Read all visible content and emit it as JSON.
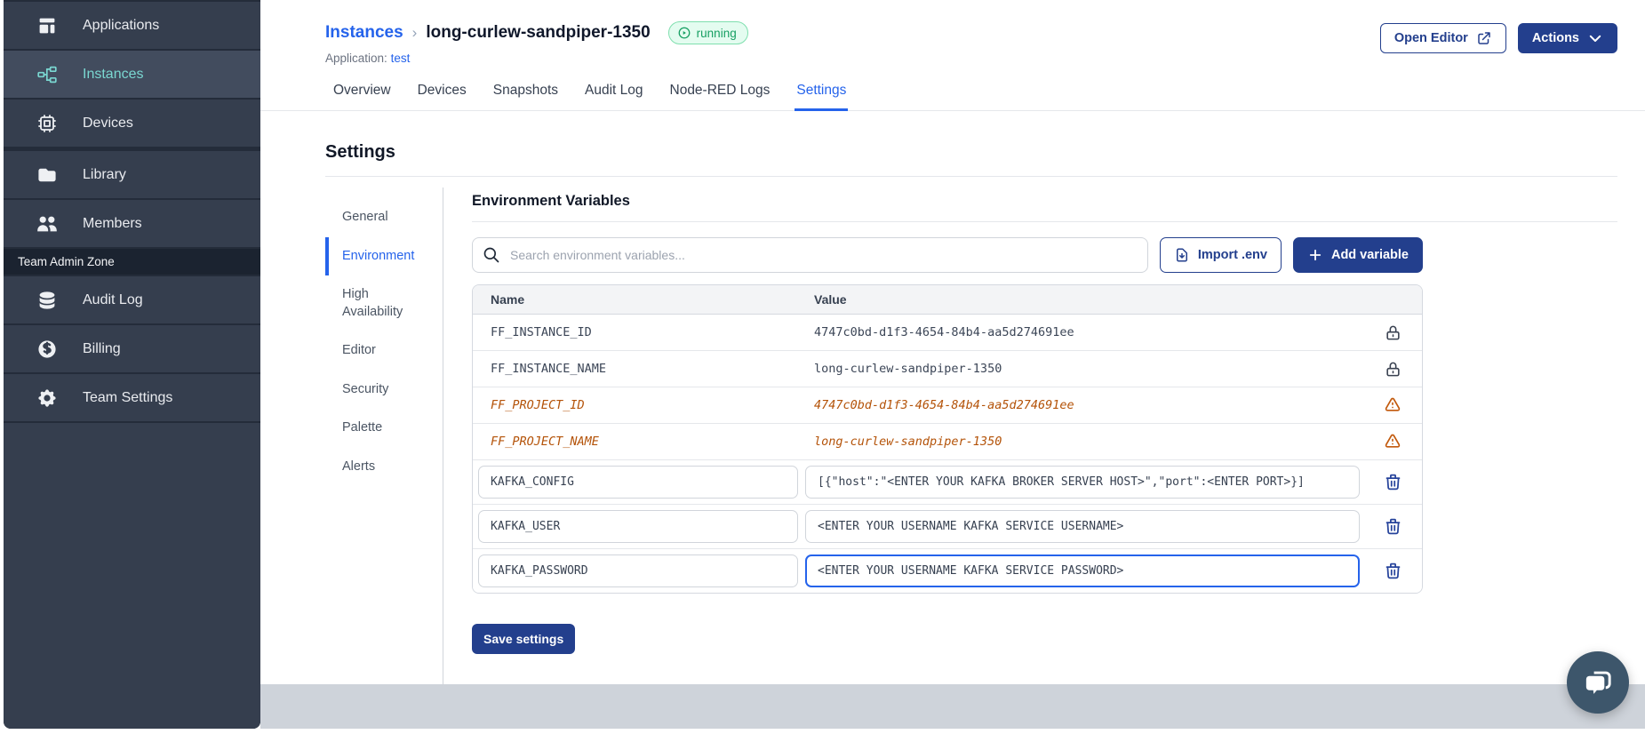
{
  "colors": {
    "primary_blue": "#233f8d",
    "link_blue": "#2563eb",
    "sidebar_active_teal": "#7ad7d1",
    "success_green": "#169f62",
    "warning_orange": "#b45309"
  },
  "sidebar": {
    "groups": [
      {
        "items": [
          {
            "label": "Applications",
            "icon": "template",
            "active": false
          },
          {
            "label": "Instances",
            "icon": "instances",
            "active": true
          },
          {
            "label": "Devices",
            "icon": "chip",
            "active": false
          }
        ]
      },
      {
        "items": [
          {
            "label": "Library",
            "icon": "folder",
            "active": false
          },
          {
            "label": "Members",
            "icon": "users",
            "active": false
          }
        ]
      }
    ],
    "admin_section_label": "Team Admin Zone",
    "admin_items": [
      {
        "label": "Audit Log",
        "icon": "database",
        "active": false
      },
      {
        "label": "Billing",
        "icon": "currency-dollar",
        "active": false
      },
      {
        "label": "Team Settings",
        "icon": "cog",
        "active": false
      }
    ]
  },
  "header": {
    "breadcrumb_parent": "Instances",
    "breadcrumb_separator": "›",
    "instance_name": "long-curlew-sandpiper-1350",
    "status_text": "running",
    "application_label": "Application:",
    "application_name": "test",
    "open_editor_label": "Open Editor",
    "actions_label": "Actions"
  },
  "tabs": {
    "items": [
      "Overview",
      "Devices",
      "Snapshots",
      "Audit Log",
      "Node-RED Logs",
      "Settings"
    ],
    "active": "Settings"
  },
  "settings": {
    "title": "Settings",
    "nav_items": [
      "General",
      "Environment",
      "High Availability",
      "Editor",
      "Security",
      "Palette",
      "Alerts"
    ],
    "nav_active": "Environment"
  },
  "env": {
    "title": "Environment Variables",
    "search_placeholder": "Search environment variables...",
    "search_value": "",
    "import_label": "Import .env",
    "add_label": "Add variable",
    "columns": [
      "Name",
      "Value"
    ],
    "rows": [
      {
        "name": "FF_INSTANCE_ID",
        "value": "4747c0bd-d1f3-4654-84b4-aa5d274691ee",
        "type": "locked"
      },
      {
        "name": "FF_INSTANCE_NAME",
        "value": "long-curlew-sandpiper-1350",
        "type": "locked"
      },
      {
        "name": "FF_PROJECT_ID",
        "value": "4747c0bd-d1f3-4654-84b4-aa5d274691ee",
        "type": "deprecated"
      },
      {
        "name": "FF_PROJECT_NAME",
        "value": "long-curlew-sandpiper-1350",
        "type": "deprecated"
      },
      {
        "name": "KAFKA_CONFIG",
        "value": "[{\"host\":\"<ENTER YOUR KAFKA BROKER SERVER HOST>\",\"port\":<ENTER PORT>}]",
        "type": "editable",
        "focused": false
      },
      {
        "name": "KAFKA_USER",
        "value": "<ENTER YOUR USERNAME KAFKA SERVICE USERNAME>",
        "type": "editable",
        "focused": false
      },
      {
        "name": "KAFKA_PASSWORD",
        "value": "<ENTER YOUR USERNAME KAFKA SERVICE PASSWORD>",
        "type": "editable",
        "focused": true
      }
    ],
    "save_label": "Save settings"
  }
}
